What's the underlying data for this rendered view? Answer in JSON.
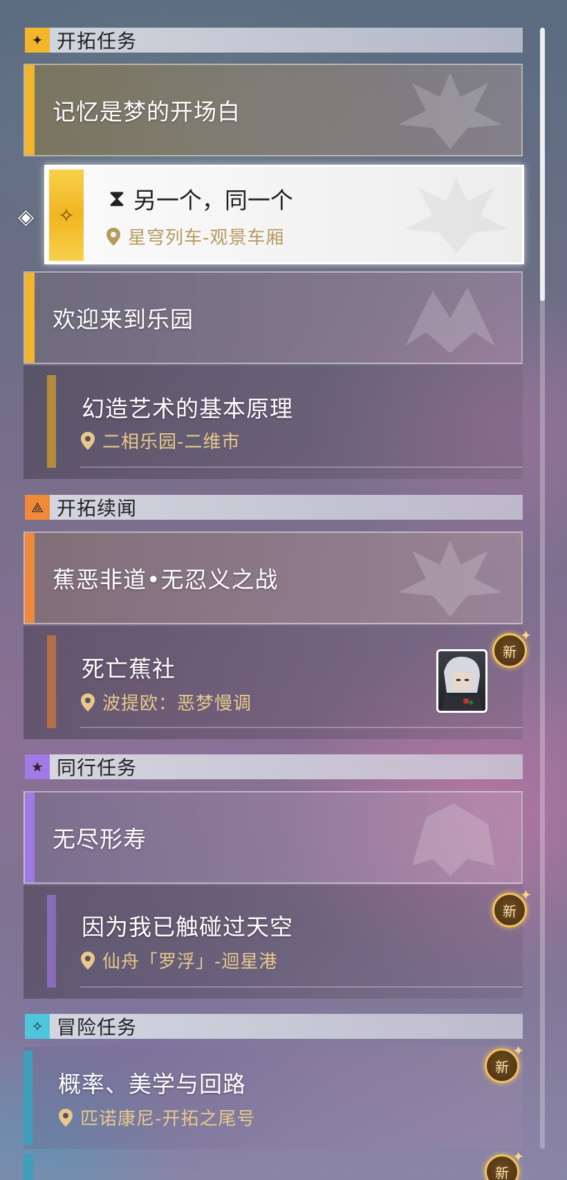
{
  "sections": {
    "trailblaze": {
      "title": "开拓任务",
      "icon": "trailblaze-mission-icon",
      "color": "#f3b62a",
      "main1": {
        "title": "记忆是梦的开场白"
      },
      "active": {
        "title": "另一个，同一个",
        "location": "星穹列车-观景车厢"
      },
      "main2": {
        "title": "欢迎来到乐园"
      },
      "sub": {
        "title": "幻造艺术的基本原理",
        "location": "二相乐园-二维市"
      }
    },
    "continuance": {
      "title": "开拓续闻",
      "icon": "continuance-mission-icon",
      "color": "#f08a3a",
      "main": {
        "title": "蕉恶非道•无忍义之战"
      },
      "sub": {
        "title": "死亡蕉社",
        "location": "波提欧：恶梦慢调",
        "badge": "新"
      }
    },
    "companion": {
      "title": "同行任务",
      "icon": "companion-mission-icon",
      "color": "#a27ae6",
      "main": {
        "title": "无尽形寿"
      },
      "sub": {
        "title": "因为我已触碰过天空",
        "location": "仙舟「罗浮」-迴星港",
        "badge": "新"
      }
    },
    "adventure": {
      "title": "冒险任务",
      "icon": "adventure-mission-icon",
      "color": "#4fc6e0",
      "item": {
        "title": "概率、美学与回路",
        "location": "匹诺康尼-开拓之尾号",
        "badge": "新"
      },
      "next_badge": "新"
    }
  }
}
